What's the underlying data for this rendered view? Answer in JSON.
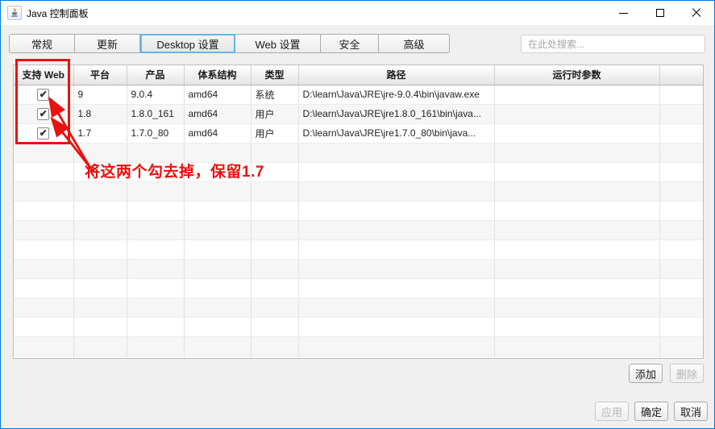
{
  "window": {
    "title": "Java 控制面板"
  },
  "tabs": [
    {
      "label": "常规",
      "selected": false
    },
    {
      "label": "更新",
      "selected": false
    },
    {
      "label": "Desktop 设置",
      "selected": true
    },
    {
      "label": "Web 设置",
      "selected": false
    },
    {
      "label": "安全",
      "selected": false
    },
    {
      "label": "高级",
      "selected": false
    }
  ],
  "search": {
    "placeholder": "在此处搜索..."
  },
  "table": {
    "columns": [
      "支持 Web",
      "平台",
      "产品",
      "体系结构",
      "类型",
      "路径",
      "运行时参数",
      ""
    ],
    "rows": [
      {
        "web_enabled": true,
        "platform": "9",
        "product": "9.0.4",
        "arch": "amd64",
        "type": "系统",
        "path": "D:\\learn\\Java\\JRE\\jre-9.0.4\\bin\\javaw.exe",
        "runtime_params": ""
      },
      {
        "web_enabled": true,
        "platform": "1.8",
        "product": "1.8.0_161",
        "arch": "amd64",
        "type": "用户",
        "path": "D:\\learn\\Java\\JRE\\jre1.8.0_161\\bin\\java...",
        "runtime_params": ""
      },
      {
        "web_enabled": true,
        "platform": "1.7",
        "product": "1.7.0_80",
        "arch": "amd64",
        "type": "用户",
        "path": "D:\\learn\\Java\\JRE\\jre1.7.0_80\\bin\\java...",
        "runtime_params": ""
      }
    ],
    "empty_row_count": 12,
    "checkbox_glyph": "✔"
  },
  "annotation": {
    "text": "将这两个勾去掉，保留1.7",
    "color": "#e8120f"
  },
  "buttons": {
    "add": {
      "label": "添加",
      "enabled": true
    },
    "remove": {
      "label": "删除",
      "enabled": false
    },
    "apply": {
      "label": "应用",
      "enabled": false
    },
    "ok": {
      "label": "确定",
      "enabled": true
    },
    "cancel": {
      "label": "取消",
      "enabled": true
    }
  },
  "colors": {
    "window_border": "#0078d7",
    "tab_highlight": "#5fb8e6",
    "annotation_red": "#e8120f"
  }
}
